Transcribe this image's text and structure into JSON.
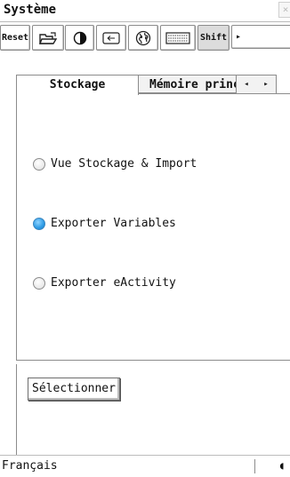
{
  "window": {
    "title": "Système",
    "close_label": "×"
  },
  "toolbar": {
    "reset_label": "Reset",
    "shift_label": "Shift",
    "buttons": [
      {
        "icon": "folder-icon"
      },
      {
        "icon": "contrast-icon"
      },
      {
        "icon": "backspace-key-icon"
      },
      {
        "icon": "globe-icon"
      },
      {
        "icon": "keyboard-icon"
      }
    ],
    "more_label": "▸"
  },
  "tabs": {
    "items": [
      {
        "label": "Stockage",
        "active": true
      },
      {
        "label": "Mémoire princi",
        "active": false
      }
    ],
    "left_arrow": "◂",
    "right_arrow": "▸"
  },
  "options": [
    {
      "label": "Vue Stockage & Import",
      "selected": false
    },
    {
      "label": "Exporter Variables",
      "selected": true
    },
    {
      "label": "Exporter eActivity",
      "selected": false
    }
  ],
  "select_button": {
    "label": "Sélectionner"
  },
  "statusbar": {
    "language": "Français",
    "battery_glyph": "◖"
  },
  "colors": {
    "accent": "#2d9be5",
    "border": "#8c8c8c"
  }
}
